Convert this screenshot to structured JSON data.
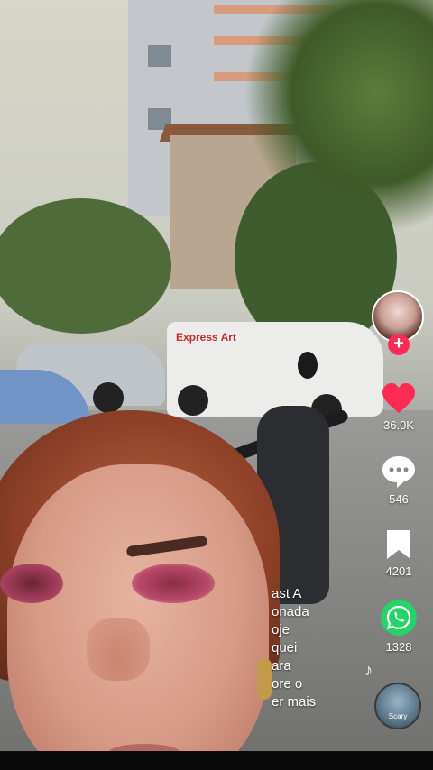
{
  "caption": {
    "lines": [
      "ast A",
      "onada",
      "oje",
      "quei",
      "ara",
      "ore o",
      "er mais"
    ]
  },
  "rail": {
    "likes": "36.0K",
    "comments": "546",
    "bookmarks": "4201",
    "shares": "1328",
    "follow_symbol": "+",
    "music_disc_label": "Scary"
  },
  "scene": {
    "van_logo": "Express Art"
  },
  "colors": {
    "accent": "#fe2c55",
    "whatsapp": "#25d366"
  },
  "icons": {
    "like": "heart-icon",
    "comment": "comment-icon",
    "bookmark": "bookmark-icon",
    "share": "whatsapp-icon",
    "music": "music-note-icon"
  }
}
